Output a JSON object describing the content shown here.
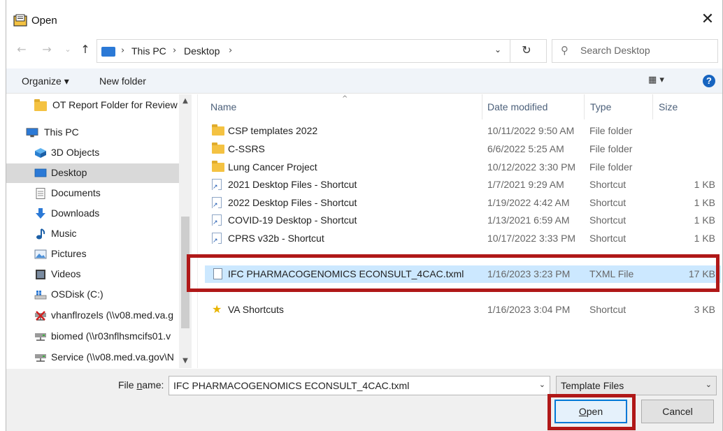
{
  "window": {
    "title": "Open",
    "close_glyph": "✕"
  },
  "nav": {
    "back_glyph": "←",
    "forward_glyph": "→",
    "recent_glyph": "⌄",
    "up_glyph": "↑",
    "breadcrumbs": [
      "This PC",
      "Desktop"
    ],
    "separator": "›",
    "dropdown_glyph": "⌄",
    "refresh_glyph": "↻",
    "search_placeholder": "Search Desktop",
    "search_glyph": "⚲"
  },
  "toolbar": {
    "organize": "Organize ▾",
    "new_folder": "New folder",
    "view_glyph": "▦ ▾",
    "help": "?"
  },
  "sidebar": {
    "items": [
      {
        "label": "OT Report Folder for Review",
        "icon": "folder-icon"
      },
      {
        "label": "This PC",
        "icon": "computer-icon"
      },
      {
        "label": "3D Objects",
        "icon": "cube-icon"
      },
      {
        "label": "Desktop",
        "icon": "desktop-icon",
        "selected": true
      },
      {
        "label": "Documents",
        "icon": "document-icon"
      },
      {
        "label": "Downloads",
        "icon": "download-icon"
      },
      {
        "label": "Music",
        "icon": "music-icon"
      },
      {
        "label": "Pictures",
        "icon": "picture-icon"
      },
      {
        "label": "Videos",
        "icon": "video-icon"
      },
      {
        "label": "OSDisk (C:)",
        "icon": "drive-icon"
      },
      {
        "label": "vhanflrozels (\\\\v08.med.va.g",
        "icon": "network-drive-disconnected-icon"
      },
      {
        "label": "biomed (\\\\r03nflhsmcifs01.v",
        "icon": "network-drive-icon"
      },
      {
        "label": "Service (\\\\v08.med.va.gov\\N",
        "icon": "network-drive-icon"
      }
    ]
  },
  "columns": {
    "name": "Name",
    "date": "Date modified",
    "type": "Type",
    "size": "Size"
  },
  "files": [
    {
      "name": "CSP templates 2022",
      "date": "10/11/2022 9:50 AM",
      "type": "File folder",
      "size": "",
      "icon": "folder-icon"
    },
    {
      "name": "C-SSRS",
      "date": "6/6/2022 5:25 AM",
      "type": "File folder",
      "size": "",
      "icon": "folder-icon"
    },
    {
      "name": "Lung Cancer Project",
      "date": "10/12/2022 3:30 PM",
      "type": "File folder",
      "size": "",
      "icon": "folder-icon"
    },
    {
      "name": "2021 Desktop Files - Shortcut",
      "date": "1/7/2021 9:29 AM",
      "type": "Shortcut",
      "size": "1 KB",
      "icon": "shortcut-icon"
    },
    {
      "name": "2022 Desktop Files - Shortcut",
      "date": "1/19/2022 4:42 AM",
      "type": "Shortcut",
      "size": "1 KB",
      "icon": "shortcut-icon"
    },
    {
      "name": "COVID-19 Desktop - Shortcut",
      "date": "1/13/2021 6:59 AM",
      "type": "Shortcut",
      "size": "1 KB",
      "icon": "shortcut-icon"
    },
    {
      "name": "CPRS v32b - Shortcut",
      "date": "10/17/2022 3:33 PM",
      "type": "Shortcut",
      "size": "1 KB",
      "icon": "shortcut-icon"
    },
    {
      "name": "IFC PHARMACOGENOMICS ECONSULT_4CAC.txml",
      "date": "1/16/2023 3:23 PM",
      "type": "TXML File",
      "size": "17 KB",
      "icon": "file-icon",
      "selected": true
    },
    {
      "name": "VA Shortcuts",
      "date": "1/16/2023 3:04 PM",
      "type": "Shortcut",
      "size": "3 KB",
      "icon": "star-shortcut-icon"
    }
  ],
  "bottom": {
    "file_name_label_pre": "File ",
    "file_name_label_u": "n",
    "file_name_label_post": "ame:",
    "file_name_value": "IFC PHARMACOGENOMICS ECONSULT_4CAC.txml",
    "file_type": "Template Files",
    "dropdown_glyph": "⌄",
    "open_label_u": "O",
    "open_label_rest": "pen",
    "cancel_label": "Cancel"
  },
  "colors": {
    "highlight": "#b01818",
    "selection": "#cce8ff",
    "accent": "#0078d7"
  }
}
